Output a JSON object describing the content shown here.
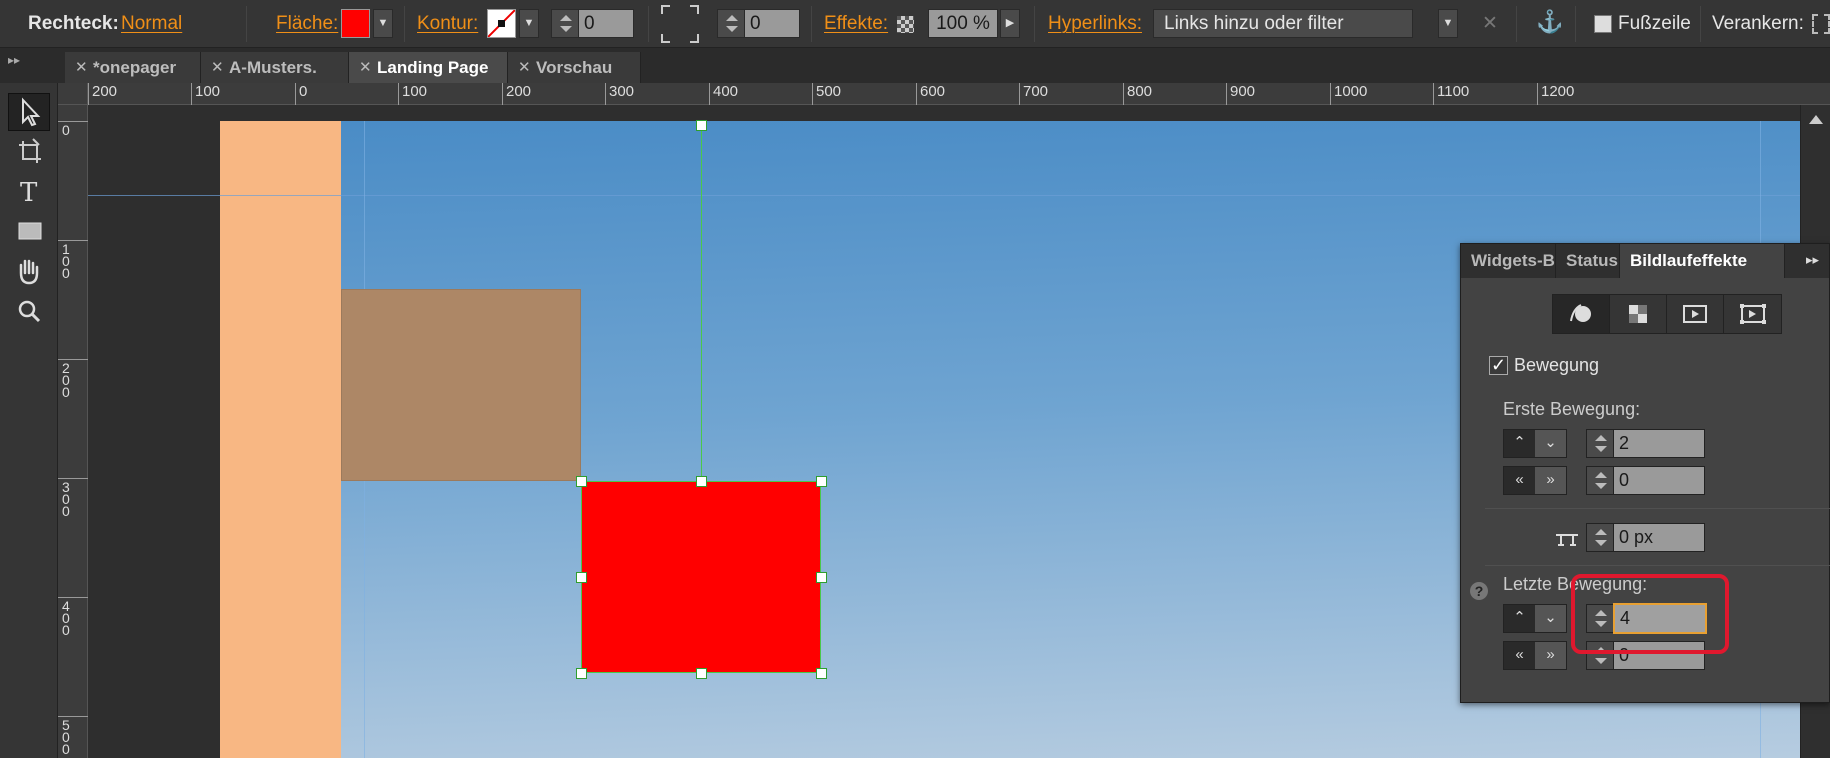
{
  "control_bar": {
    "object_type_label": "Rechteck:",
    "state_link": "Normal",
    "fill_label": "Fläche:",
    "fill_color": "#ff0000",
    "stroke_label": "Kontur:",
    "stroke_width": "0",
    "corner_radius": "0",
    "effects_label": "Effekte:",
    "opacity": "100 %",
    "hyperlinks_label": "Hyperlinks:",
    "hyperlinks_placeholder": "Links hinzu oder filter",
    "footer_label": "Fußzeile",
    "anchor_label": "Verankern:"
  },
  "tabs": [
    {
      "label": "*onepager",
      "active": false
    },
    {
      "label": "A-Musters.",
      "active": false
    },
    {
      "label": "Landing Page",
      "active": true
    },
    {
      "label": "Vorschau",
      "active": false
    }
  ],
  "tools": [
    "selection-icon",
    "crop-icon",
    "text-icon",
    "rectangle-icon",
    "hand-icon",
    "zoom-icon"
  ],
  "ruler": {
    "horizontal": [
      "200",
      "100",
      "0",
      "100",
      "200",
      "300",
      "400",
      "500",
      "600",
      "700",
      "800",
      "900",
      "1000",
      "1100",
      "1200"
    ],
    "vertical": [
      "0",
      "1\n0\n0",
      "2\n0\n0",
      "3\n0\n0",
      "4\n0\n0",
      "5\n0\n0"
    ]
  },
  "panel": {
    "tabs": [
      "Widgets-B",
      "Status",
      "Bildlaufeffekte"
    ],
    "active_tab": "Bildlaufeffekte",
    "effect_icons": [
      "motion-icon",
      "opacity-icon",
      "slideshow-icon",
      "adobe-edge-icon"
    ],
    "motion_checkbox_label": "Bewegung",
    "motion_checked": true,
    "first_motion_label": "Erste Bewegung:",
    "first_vertical_value": "2",
    "first_horizontal_value": "0",
    "position_value": "0 px",
    "last_motion_label": "Letzte Bewegung:",
    "last_vertical_value": "4",
    "last_horizontal_value": "0",
    "help_label": "?"
  }
}
